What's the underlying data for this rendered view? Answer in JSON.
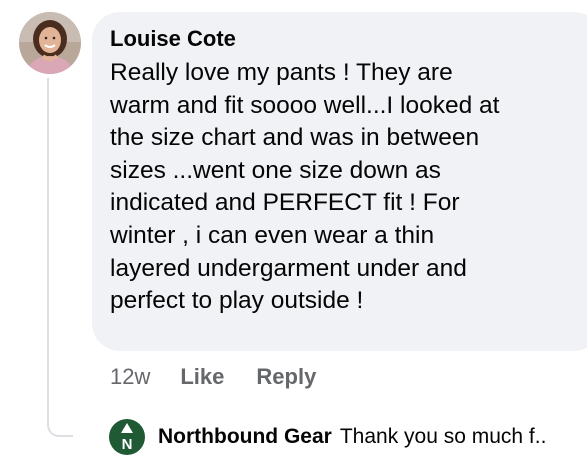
{
  "comment": {
    "author": "Louise Cote",
    "text": "Really love my pants ! They are\nwarm and fit soooo well...I looked at\nthe size chart and was in between\nsizes ...went one size down as\nindicated and PERFECT fit ! For\nwinter , i can even wear a thin\nlayered undergarment under and\nperfect to play outside  !",
    "time": "12w",
    "like_label": "Like",
    "reply_label": "Reply"
  },
  "reply_preview": {
    "author": "Northbound Gear",
    "text": "Thank you so much f..",
    "logo_letter": "N"
  },
  "colors": {
    "bubble": "#f0f2f5",
    "text": "#050505",
    "secondary_text": "#65676b",
    "brand_green": "#1f5a34"
  }
}
